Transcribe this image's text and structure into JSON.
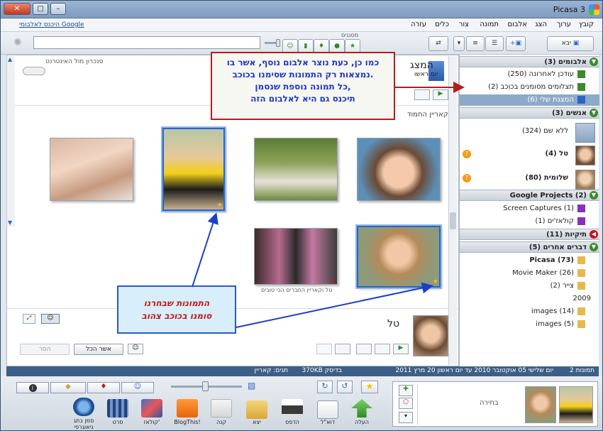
{
  "window": {
    "title": "Picasa 3",
    "min": "–",
    "max": "□",
    "close": "✕"
  },
  "menu": {
    "items": [
      "קובץ",
      "ערוך",
      "הצג",
      "אלבום",
      "תמונה",
      "צור",
      "כלים",
      "עזרה"
    ],
    "signin": "היכנס לאלבומי Google"
  },
  "toolbar": {
    "import": "יבא",
    "filters_label": "מסננים",
    "search_placeholder": ""
  },
  "left": {
    "sections": [
      {
        "title": "אלבומים (3)",
        "color": "#3a8a2c"
      },
      {
        "title": "אנשים (3)",
        "color": "#3a8a2c"
      },
      {
        "title": "Google Projects (2)",
        "color": "#3a8a2c"
      },
      {
        "title": "תיקיות (11)",
        "color": "#c0181c"
      },
      {
        "title": "דברים אחרים (5)",
        "color": "#3a8a2c"
      }
    ],
    "albums": [
      "עודכן לאחרונה (250)",
      "תצלומים מסומנים בכוכב (2)",
      "המצגת שלי (6)"
    ],
    "people": [
      "ללא שם (324)",
      "טל (4)",
      "שלומית (80)"
    ],
    "projects": [
      "Screen Captures (1)",
      "קולאז'ים (1)"
    ],
    "folders": [
      "Picasa (73)",
      "Movie Maker (26)",
      "צייר (2)"
    ],
    "year": "2009",
    "year_folders": [
      "images (14)",
      "images (5)"
    ]
  },
  "main": {
    "album_title_partial": "המצג",
    "album_date_partial": "יום ראשו",
    "internet_sync": "סנכרון מול האינטרנט",
    "caption_partial": "קאריין החמוד",
    "photo_caption": "טל וקאריין החברים הכי טובים",
    "person_name": "טל",
    "confirm_all": "אשר הכל",
    "remove": "הסר"
  },
  "callouts": {
    "top": [
      "כמו כן, כעת נוצר אלבום נוסף, אשר בו",
      "נמצאות רק התמונות שסימנו בכוכב.",
      "כל תמונה נוספת שנסמן,",
      "תיכנס גם היא לאלבום הזה"
    ],
    "bottom": [
      "התמונות שבחרנו",
      "סומנו בכוכב צהוב"
    ]
  },
  "status": {
    "count": "2 תמונות",
    "range": "יום שלישי 05 אוקטובר 2010 עד יום ראשון 20 מרץ 2011",
    "size": "370KB בדיסק",
    "tags": "תגים: קאריין"
  },
  "bottom": {
    "selection": "בחירה",
    "actions": [
      "העלה",
      "דוא\"ל",
      "הדפס",
      "יצא",
      "קנה",
      "BlogThis!",
      "קולאז'",
      "סרט",
      "סמן בתג גיאוגרפי"
    ]
  },
  "colors": {
    "accent": "#2a66c7",
    "callout_border": "#b31d1d",
    "star": "#f2c300"
  }
}
